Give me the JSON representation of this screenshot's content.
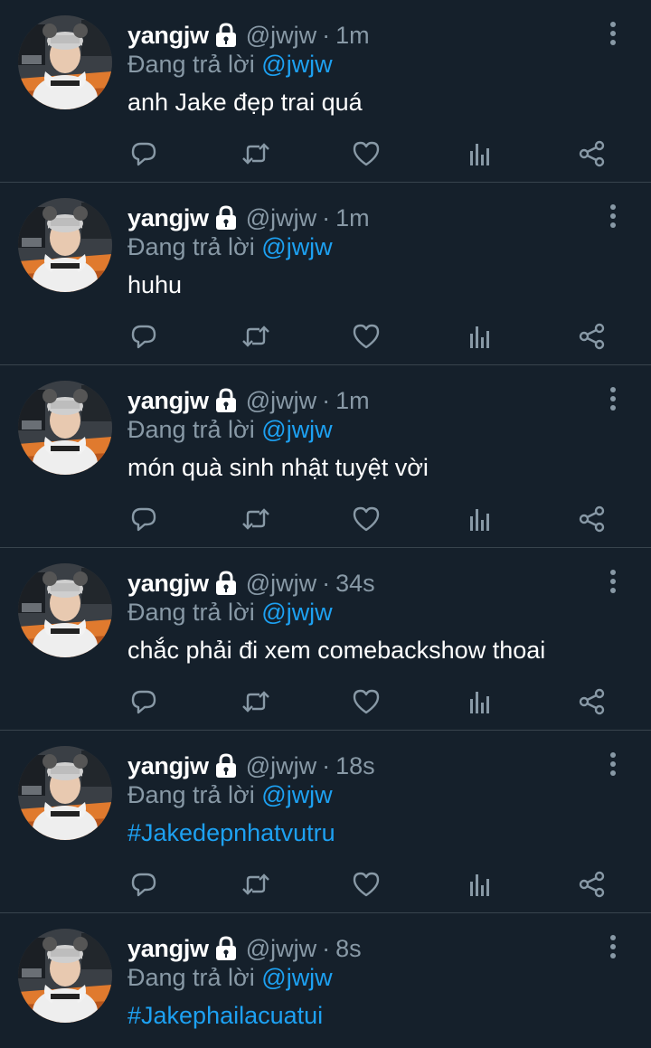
{
  "colors": {
    "background": "#15202b",
    "divider": "#38444d",
    "muted": "#8899a6",
    "accent": "#1da1f2",
    "text": "#ffffff"
  },
  "icons": {
    "lock": "lock-icon",
    "more": "more-vertical-icon",
    "reply": "reply-icon",
    "retweet": "retweet-icon",
    "like": "heart-icon",
    "stats": "bar-chart-icon",
    "share": "share-icon"
  },
  "tweets": [
    {
      "name": "yangjw",
      "handle": "@jwjw",
      "separator": "·",
      "time": "1m",
      "reply_prefix": "Đang trả lời",
      "reply_to": "@jwjw",
      "text": "anh Jake đẹp trai quá",
      "is_hashtag": false
    },
    {
      "name": "yangjw",
      "handle": "@jwjw",
      "separator": "·",
      "time": "1m",
      "reply_prefix": "Đang trả lời",
      "reply_to": "@jwjw",
      "text": "huhu",
      "is_hashtag": false
    },
    {
      "name": "yangjw",
      "handle": "@jwjw",
      "separator": "·",
      "time": "1m",
      "reply_prefix": "Đang trả lời",
      "reply_to": "@jwjw",
      "text": "món quà sinh nhật tuyệt vời",
      "is_hashtag": false
    },
    {
      "name": "yangjw",
      "handle": "@jwjw",
      "separator": "·",
      "time": "34s",
      "reply_prefix": "Đang trả lời",
      "reply_to": "@jwjw",
      "text": "chắc phải đi xem comebackshow thoai",
      "is_hashtag": false
    },
    {
      "name": "yangjw",
      "handle": "@jwjw",
      "separator": "·",
      "time": "18s",
      "reply_prefix": "Đang trả lời",
      "reply_to": "@jwjw",
      "text": "#Jakedepnhatvutru",
      "is_hashtag": true
    },
    {
      "name": "yangjw",
      "handle": "@jwjw",
      "separator": "·",
      "time": "8s",
      "reply_prefix": "Đang trả lời",
      "reply_to": "@jwjw",
      "text": "#Jakephailacuatui",
      "is_hashtag": true
    }
  ]
}
